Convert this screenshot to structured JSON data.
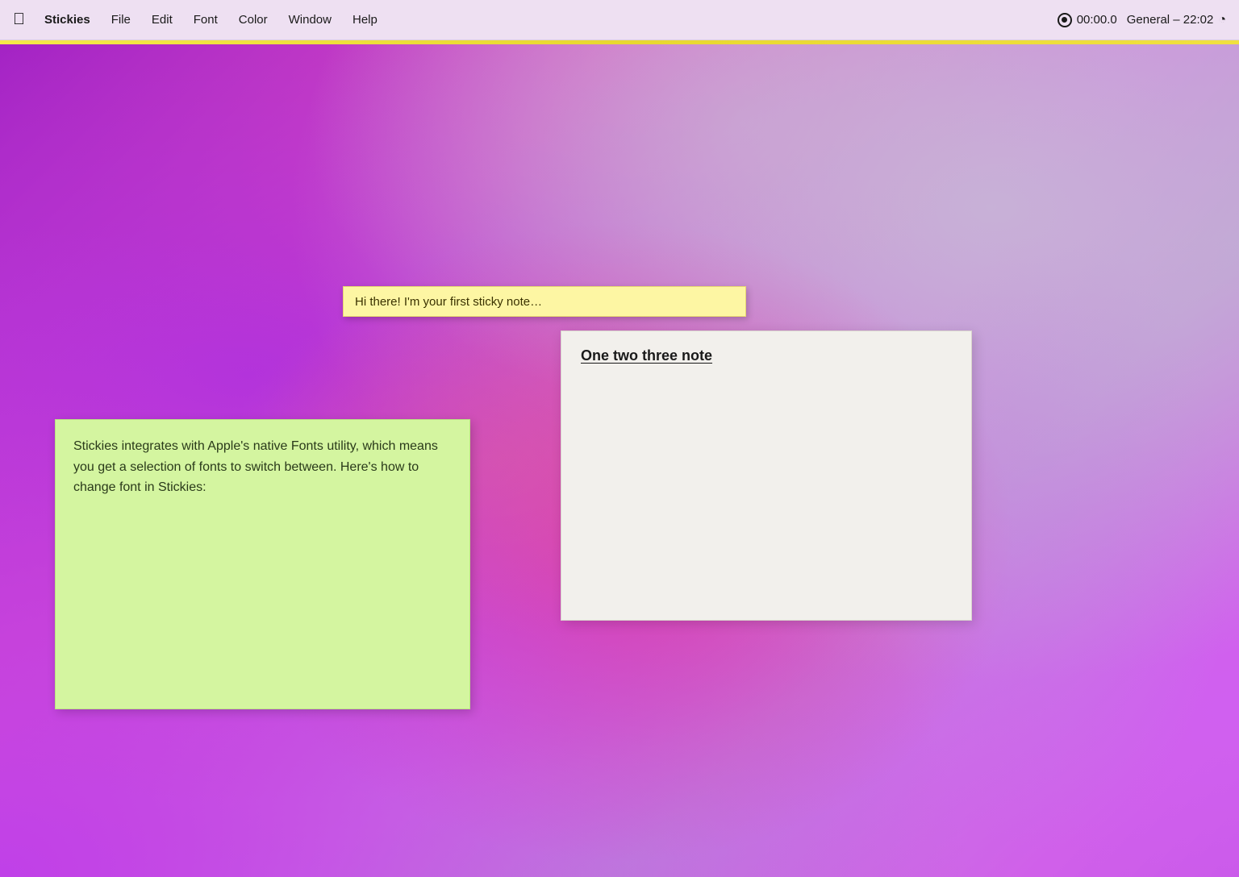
{
  "menubar": {
    "apple_symbol": "",
    "app_name": "Stickies",
    "items": [
      {
        "id": "file",
        "label": "File"
      },
      {
        "id": "edit",
        "label": "Edit"
      },
      {
        "id": "font",
        "label": "Font"
      },
      {
        "id": "color",
        "label": "Color"
      },
      {
        "id": "window",
        "label": "Window"
      },
      {
        "id": "help",
        "label": "Help"
      }
    ],
    "timer": "00:00.0",
    "general": "General – 22:02"
  },
  "stickies": {
    "yellow": {
      "text": "Hi there! I'm your first sticky note…"
    },
    "green": {
      "text": "Stickies integrates with Apple's native Fonts utility, which means you get a selection of fonts to switch between. Here's how to change font in Stickies:"
    },
    "white": {
      "title": "One two three note"
    }
  }
}
